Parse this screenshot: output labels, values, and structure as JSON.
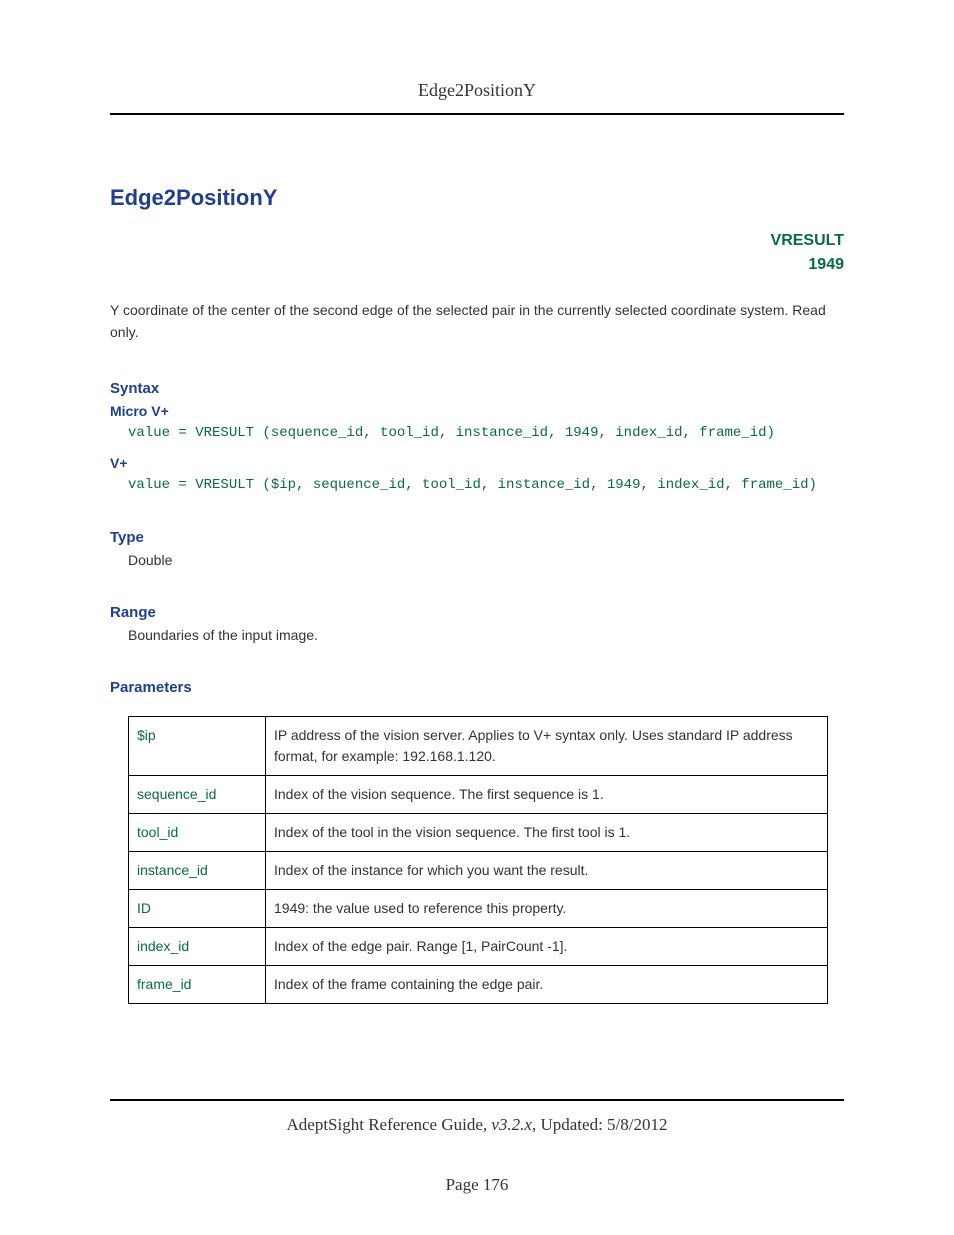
{
  "header": {
    "title": "Edge2PositionY"
  },
  "main": {
    "title": "Edge2PositionY",
    "vresult_label": "VRESULT",
    "vresult_code": "1949",
    "description": "Y coordinate of the center of the second edge of the selected pair in the currently selected coordinate system. Read only.",
    "syntax": {
      "heading": "Syntax",
      "micro_label": "Micro V+",
      "micro_code": "value = VRESULT (sequence_id, tool_id, instance_id, 1949, index_id, frame_id)",
      "vplus_label": "V+",
      "vplus_code": "value = VRESULT ($ip, sequence_id, tool_id, instance_id, 1949, index_id, frame_id)"
    },
    "type": {
      "heading": "Type",
      "value": "Double"
    },
    "range": {
      "heading": "Range",
      "value": "Boundaries of the input image."
    },
    "parameters": {
      "heading": "Parameters",
      "rows": [
        {
          "name": "$ip",
          "desc": "IP address of the vision server. Applies to V+ syntax only. Uses standard IP address format, for example: 192.168.1.120."
        },
        {
          "name": "sequence_id",
          "desc": "Index of the vision sequence. The first sequence is 1."
        },
        {
          "name": "tool_id",
          "desc": "Index of the tool in the vision sequence. The first tool is 1."
        },
        {
          "name": "instance_id",
          "desc": "Index of the instance for which you want the result."
        },
        {
          "name": "ID",
          "desc": "1949: the value used to reference this property."
        },
        {
          "name": "index_id",
          "desc": "Index of the edge pair. Range [1, PairCount -1]."
        },
        {
          "name": "frame_id",
          "desc": "Index of the frame containing the edge pair."
        }
      ]
    }
  },
  "footer": {
    "guide": "AdeptSight Reference Guide",
    "version": ", v3.2.x",
    "updated": ", Updated: 5/8/2012",
    "page": "Page 176"
  }
}
